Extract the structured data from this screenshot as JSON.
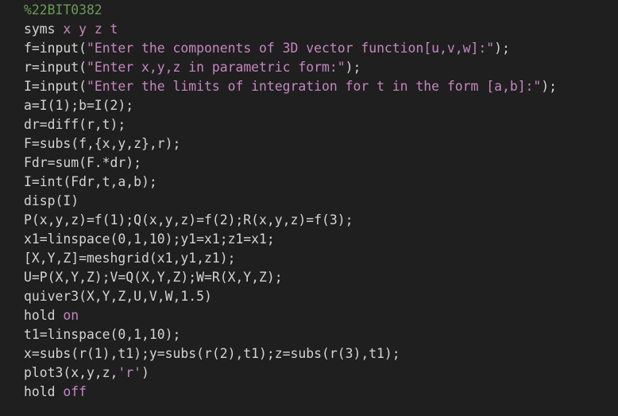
{
  "colors": {
    "background": "#1f1f1f",
    "text": "#d4d4d4",
    "comment": "#6a9955",
    "keyword": "#569cd6",
    "string": "#c586c0"
  },
  "code": {
    "lines": [
      [
        {
          "t": "%22BIT0382",
          "k": "comment"
        }
      ],
      [
        {
          "t": "syms",
          "k": "plain"
        },
        {
          "t": " x y z t",
          "k": "str"
        }
      ],
      [
        {
          "t": "f=input(",
          "k": "plain"
        },
        {
          "t": "\"Enter the components of 3D vector function[u,v,w]:\"",
          "k": "str"
        },
        {
          "t": ");",
          "k": "plain"
        }
      ],
      [
        {
          "t": "r=input(",
          "k": "plain"
        },
        {
          "t": "\"Enter x,y,z in parametric form:\"",
          "k": "str"
        },
        {
          "t": ");",
          "k": "plain"
        }
      ],
      [
        {
          "t": "I=input(",
          "k": "plain"
        },
        {
          "t": "\"Enter the limits of integration for t in the form [a,b]:\"",
          "k": "str"
        },
        {
          "t": ");",
          "k": "plain"
        }
      ],
      [
        {
          "t": "a=I(1);b=I(2);",
          "k": "plain"
        }
      ],
      [
        {
          "t": "dr=diff(r,t);",
          "k": "plain"
        }
      ],
      [
        {
          "t": "F=subs(f,{x,y,z},r);",
          "k": "plain"
        }
      ],
      [
        {
          "t": "Fdr=sum(F.*dr);",
          "k": "plain"
        }
      ],
      [
        {
          "t": "I=int(Fdr,t,a,b);",
          "k": "plain"
        }
      ],
      [
        {
          "t": "disp(I)",
          "k": "plain"
        }
      ],
      [
        {
          "t": "P(x,y,z)=f(1);Q(x,y,z)=f(2);R(x,y,z)=f(3);",
          "k": "plain"
        }
      ],
      [
        {
          "t": "x1=linspace(0,1,10);y1=x1;z1=x1;",
          "k": "plain"
        }
      ],
      [
        {
          "t": "[X,Y,Z]=meshgrid(x1,y1,z1);",
          "k": "plain"
        }
      ],
      [
        {
          "t": "U=P(X,Y,Z);V=Q(X,Y,Z);W=R(X,Y,Z);",
          "k": "plain"
        }
      ],
      [
        {
          "t": "quiver3(X,Y,Z,U,V,W,1.5)",
          "k": "plain"
        }
      ],
      [
        {
          "t": "hold",
          "k": "plain"
        },
        {
          "t": " on",
          "k": "str"
        }
      ],
      [
        {
          "t": "t1=linspace(0,1,10);",
          "k": "plain"
        }
      ],
      [
        {
          "t": "x=subs(r(1),t1);y=subs(r(2),t1);z=subs(r(3),t1);",
          "k": "plain"
        }
      ],
      [
        {
          "t": "plot3(x,y,z,",
          "k": "plain"
        },
        {
          "t": "'r'",
          "k": "str"
        },
        {
          "t": ")",
          "k": "plain"
        }
      ],
      [
        {
          "t": "hold",
          "k": "plain"
        },
        {
          "t": " off",
          "k": "str"
        }
      ]
    ]
  }
}
